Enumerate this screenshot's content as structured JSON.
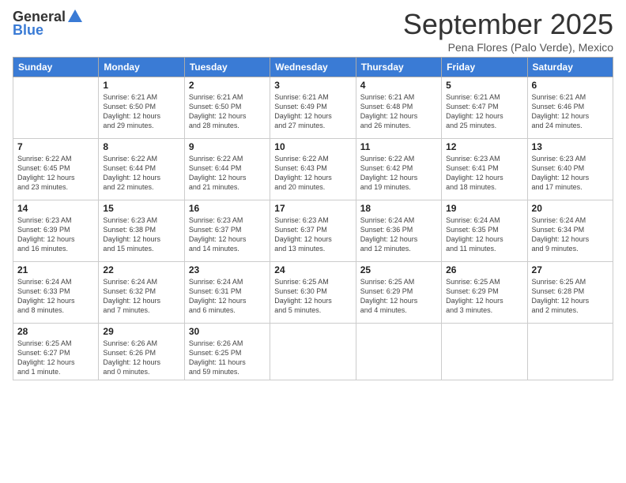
{
  "header": {
    "logo_general": "General",
    "logo_blue": "Blue",
    "month_title": "September 2025",
    "subtitle": "Pena Flores (Palo Verde), Mexico"
  },
  "days_of_week": [
    "Sunday",
    "Monday",
    "Tuesday",
    "Wednesday",
    "Thursday",
    "Friday",
    "Saturday"
  ],
  "weeks": [
    [
      {
        "day": "",
        "info": ""
      },
      {
        "day": "1",
        "info": "Sunrise: 6:21 AM\nSunset: 6:50 PM\nDaylight: 12 hours\nand 29 minutes."
      },
      {
        "day": "2",
        "info": "Sunrise: 6:21 AM\nSunset: 6:50 PM\nDaylight: 12 hours\nand 28 minutes."
      },
      {
        "day": "3",
        "info": "Sunrise: 6:21 AM\nSunset: 6:49 PM\nDaylight: 12 hours\nand 27 minutes."
      },
      {
        "day": "4",
        "info": "Sunrise: 6:21 AM\nSunset: 6:48 PM\nDaylight: 12 hours\nand 26 minutes."
      },
      {
        "day": "5",
        "info": "Sunrise: 6:21 AM\nSunset: 6:47 PM\nDaylight: 12 hours\nand 25 minutes."
      },
      {
        "day": "6",
        "info": "Sunrise: 6:21 AM\nSunset: 6:46 PM\nDaylight: 12 hours\nand 24 minutes."
      }
    ],
    [
      {
        "day": "7",
        "info": "Sunrise: 6:22 AM\nSunset: 6:45 PM\nDaylight: 12 hours\nand 23 minutes."
      },
      {
        "day": "8",
        "info": "Sunrise: 6:22 AM\nSunset: 6:44 PM\nDaylight: 12 hours\nand 22 minutes."
      },
      {
        "day": "9",
        "info": "Sunrise: 6:22 AM\nSunset: 6:44 PM\nDaylight: 12 hours\nand 21 minutes."
      },
      {
        "day": "10",
        "info": "Sunrise: 6:22 AM\nSunset: 6:43 PM\nDaylight: 12 hours\nand 20 minutes."
      },
      {
        "day": "11",
        "info": "Sunrise: 6:22 AM\nSunset: 6:42 PM\nDaylight: 12 hours\nand 19 minutes."
      },
      {
        "day": "12",
        "info": "Sunrise: 6:23 AM\nSunset: 6:41 PM\nDaylight: 12 hours\nand 18 minutes."
      },
      {
        "day": "13",
        "info": "Sunrise: 6:23 AM\nSunset: 6:40 PM\nDaylight: 12 hours\nand 17 minutes."
      }
    ],
    [
      {
        "day": "14",
        "info": "Sunrise: 6:23 AM\nSunset: 6:39 PM\nDaylight: 12 hours\nand 16 minutes."
      },
      {
        "day": "15",
        "info": "Sunrise: 6:23 AM\nSunset: 6:38 PM\nDaylight: 12 hours\nand 15 minutes."
      },
      {
        "day": "16",
        "info": "Sunrise: 6:23 AM\nSunset: 6:37 PM\nDaylight: 12 hours\nand 14 minutes."
      },
      {
        "day": "17",
        "info": "Sunrise: 6:23 AM\nSunset: 6:37 PM\nDaylight: 12 hours\nand 13 minutes."
      },
      {
        "day": "18",
        "info": "Sunrise: 6:24 AM\nSunset: 6:36 PM\nDaylight: 12 hours\nand 12 minutes."
      },
      {
        "day": "19",
        "info": "Sunrise: 6:24 AM\nSunset: 6:35 PM\nDaylight: 12 hours\nand 11 minutes."
      },
      {
        "day": "20",
        "info": "Sunrise: 6:24 AM\nSunset: 6:34 PM\nDaylight: 12 hours\nand 9 minutes."
      }
    ],
    [
      {
        "day": "21",
        "info": "Sunrise: 6:24 AM\nSunset: 6:33 PM\nDaylight: 12 hours\nand 8 minutes."
      },
      {
        "day": "22",
        "info": "Sunrise: 6:24 AM\nSunset: 6:32 PM\nDaylight: 12 hours\nand 7 minutes."
      },
      {
        "day": "23",
        "info": "Sunrise: 6:24 AM\nSunset: 6:31 PM\nDaylight: 12 hours\nand 6 minutes."
      },
      {
        "day": "24",
        "info": "Sunrise: 6:25 AM\nSunset: 6:30 PM\nDaylight: 12 hours\nand 5 minutes."
      },
      {
        "day": "25",
        "info": "Sunrise: 6:25 AM\nSunset: 6:29 PM\nDaylight: 12 hours\nand 4 minutes."
      },
      {
        "day": "26",
        "info": "Sunrise: 6:25 AM\nSunset: 6:29 PM\nDaylight: 12 hours\nand 3 minutes."
      },
      {
        "day": "27",
        "info": "Sunrise: 6:25 AM\nSunset: 6:28 PM\nDaylight: 12 hours\nand 2 minutes."
      }
    ],
    [
      {
        "day": "28",
        "info": "Sunrise: 6:25 AM\nSunset: 6:27 PM\nDaylight: 12 hours\nand 1 minute."
      },
      {
        "day": "29",
        "info": "Sunrise: 6:26 AM\nSunset: 6:26 PM\nDaylight: 12 hours\nand 0 minutes."
      },
      {
        "day": "30",
        "info": "Sunrise: 6:26 AM\nSunset: 6:25 PM\nDaylight: 11 hours\nand 59 minutes."
      },
      {
        "day": "",
        "info": ""
      },
      {
        "day": "",
        "info": ""
      },
      {
        "day": "",
        "info": ""
      },
      {
        "day": "",
        "info": ""
      }
    ]
  ]
}
